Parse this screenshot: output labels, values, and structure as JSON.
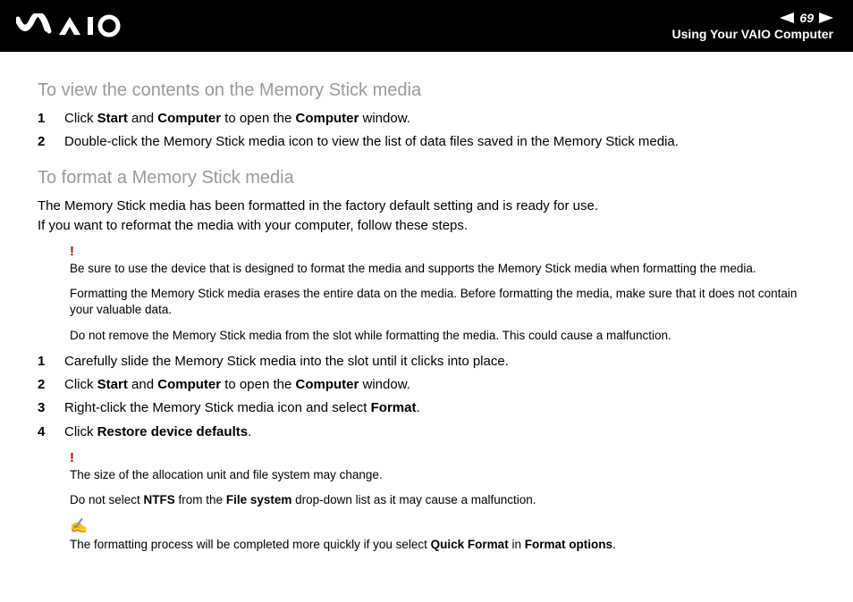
{
  "header": {
    "page_number": "69",
    "subtitle": "Using Your VAIO Computer"
  },
  "section1": {
    "title": "To view the contents on the Memory Stick media",
    "steps": [
      {
        "n": "1",
        "html": "Click <b>Start</b> and <b>Computer</b> to open the <b>Computer</b> window."
      },
      {
        "n": "2",
        "html": "Double-click the Memory Stick media icon to view the list of data files saved in the Memory Stick media."
      }
    ]
  },
  "section2": {
    "title": "To format a Memory Stick media",
    "intro_line1": "The Memory Stick media has been formatted in the factory default setting and is ready for use.",
    "intro_line2": "If you want to reformat the media with your computer, follow these steps.",
    "warn1_mark": "!",
    "warn1_a": "Be sure to use the device that is designed to format the media and supports the Memory Stick media when formatting the media.",
    "warn1_b": "Formatting the Memory Stick media erases the entire data on the media. Before formatting the media, make sure that it does not contain your valuable data.",
    "warn1_c": "Do not remove the Memory Stick media from the slot while formatting the media. This could cause a malfunction.",
    "steps": [
      {
        "n": "1",
        "html": "Carefully slide the Memory Stick media into the slot until it clicks into place."
      },
      {
        "n": "2",
        "html": "Click <b>Start</b> and <b>Computer</b> to open the <b>Computer</b> window."
      },
      {
        "n": "3",
        "html": "Right-click the Memory Stick media icon and select <b>Format</b>."
      },
      {
        "n": "4",
        "html": "Click <b>Restore device defaults</b>."
      }
    ],
    "warn2_mark": "!",
    "warn2_a": "The size of the allocation unit and file system may change.",
    "warn2_b_html": "Do not select <b>NTFS</b> from the <b>File system</b> drop-down list as it may cause a malfunction.",
    "note_mark": "✍",
    "note_html": "The formatting process will be completed more quickly if you select <b>Quick Format</b> in <b>Format options</b>."
  }
}
